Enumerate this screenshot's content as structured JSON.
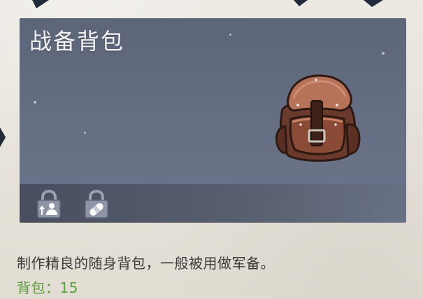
{
  "item": {
    "name": "战备背包",
    "description": "制作精良的随身背包，一般被用做军备。",
    "stat_label": "背包：",
    "stat_value": "15"
  },
  "tags": [
    {
      "icon": "lock-person-icon",
      "locked": true
    },
    {
      "icon": "lock-bandage-icon",
      "locked": true
    }
  ],
  "colors": {
    "panel": "#636b80",
    "title": "#f4f4f4",
    "description": "#3a3a3a",
    "stat": "#5a9e3a"
  }
}
